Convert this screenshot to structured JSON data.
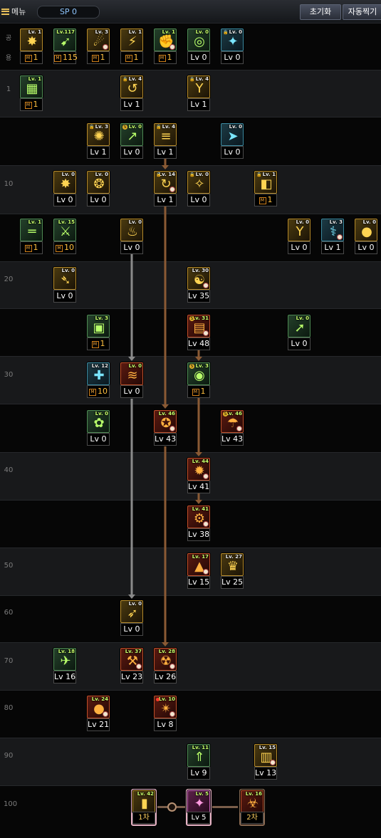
{
  "topbar": {
    "menu_label": "메뉴",
    "sp_label": "SP 0",
    "reset_label": "초기화",
    "auto_label": "자동찍기"
  },
  "common_label": "공 용",
  "row_labels": [
    "1",
    "10",
    "20",
    "30",
    "40",
    "50",
    "60",
    "70",
    "80",
    "90",
    "100"
  ],
  "skills": [
    {
      "id": "c1",
      "tag": "Lv. 1",
      "level": "1",
      "m": true,
      "color": "y",
      "glyph": "✸"
    },
    {
      "id": "c2",
      "tag": "Lv.117",
      "level": "115",
      "m": true,
      "color": "g",
      "glyph": "➹"
    },
    {
      "id": "c3",
      "tag": "Lv. 3",
      "level": "1",
      "m": true,
      "color": "y",
      "glyph": "☄"
    },
    {
      "id": "c4",
      "tag": "Lv. 1",
      "level": "1",
      "m": true,
      "color": "y",
      "glyph": "⚡"
    },
    {
      "id": "c5",
      "tag": "Lv. 1",
      "level": "1",
      "m": true,
      "color": "g",
      "glyph": "✊"
    },
    {
      "id": "c6",
      "tag": "Lv. 0",
      "level": "Lv 0",
      "m": false,
      "color": "g",
      "glyph": "◎"
    },
    {
      "id": "c7",
      "tag": "Lv. 0",
      "level": "Lv 0",
      "m": false,
      "color": "t",
      "glyph": "✦"
    },
    {
      "id": "r1a",
      "tag": "Lv. 1",
      "level": "1",
      "m": true,
      "color": "g",
      "glyph": "▦"
    },
    {
      "id": "r1b",
      "tag": "Lv. 4",
      "level": "Lv 1",
      "m": false,
      "color": "y",
      "glyph": "↺"
    },
    {
      "id": "r1c",
      "tag": "Lv. 4",
      "level": "Lv 1",
      "m": false,
      "color": "y",
      "glyph": "Y"
    },
    {
      "id": "r5a",
      "tag": "Lv. 3",
      "level": "Lv 1",
      "m": false,
      "color": "y",
      "glyph": "✺"
    },
    {
      "id": "r5b",
      "tag": "Lv. 0",
      "level": "Lv 0",
      "m": false,
      "color": "g",
      "glyph": "↗"
    },
    {
      "id": "r5c",
      "tag": "Lv. 4",
      "level": "Lv 1",
      "m": false,
      "color": "y",
      "glyph": "≡"
    },
    {
      "id": "r5d",
      "tag": "Lv. 0",
      "level": "Lv 0",
      "m": false,
      "color": "t",
      "glyph": "➤"
    },
    {
      "id": "r10a",
      "tag": "Lv. 0",
      "level": "Lv 0",
      "m": false,
      "color": "y",
      "glyph": "✸"
    },
    {
      "id": "r10b",
      "tag": "Lv. 0",
      "level": "Lv 0",
      "m": false,
      "color": "y",
      "glyph": "❂"
    },
    {
      "id": "r10c",
      "tag": "Lv. 14",
      "level": "Lv 1",
      "m": false,
      "color": "y",
      "glyph": "↻"
    },
    {
      "id": "r10d",
      "tag": "Lv. 0",
      "level": "Lv 0",
      "m": false,
      "color": "y",
      "glyph": "✧"
    },
    {
      "id": "r10e",
      "tag": "Lv. 1",
      "level": "1",
      "m": true,
      "color": "y",
      "glyph": "◧"
    },
    {
      "id": "r15a",
      "tag": "Lv. 1",
      "level": "1",
      "m": true,
      "color": "g",
      "glyph": "═"
    },
    {
      "id": "r15b",
      "tag": "Lv. 15",
      "level": "10",
      "m": true,
      "color": "g",
      "glyph": "⚔"
    },
    {
      "id": "r15c",
      "tag": "Lv. 0",
      "level": "Lv 0",
      "m": false,
      "color": "y",
      "glyph": "♨"
    },
    {
      "id": "r15d",
      "tag": "Lv. 0",
      "level": "Lv 0",
      "m": false,
      "color": "y",
      "glyph": "Y"
    },
    {
      "id": "r15e",
      "tag": "Lv. 3",
      "level": "Lv 1",
      "m": false,
      "color": "t",
      "glyph": "⚕"
    },
    {
      "id": "r15f",
      "tag": "Lv. 0",
      "level": "Lv 0",
      "m": false,
      "color": "y",
      "glyph": "●"
    },
    {
      "id": "r20a",
      "tag": "Lv. 0",
      "level": "Lv 0",
      "m": false,
      "color": "y",
      "glyph": "➴"
    },
    {
      "id": "r20b",
      "tag": "Lv. 30",
      "level": "Lv 35",
      "m": false,
      "color": "y",
      "glyph": "☯"
    },
    {
      "id": "r25a",
      "tag": "Lv. 3",
      "level": "1",
      "m": true,
      "color": "g",
      "glyph": "▣"
    },
    {
      "id": "r25b",
      "tag": "Lv. 31",
      "level": "Lv 48",
      "m": false,
      "color": "r",
      "glyph": "▤"
    },
    {
      "id": "r25c",
      "tag": "Lv. 0",
      "level": "Lv 0",
      "m": false,
      "color": "g",
      "glyph": "➚"
    },
    {
      "id": "r30a",
      "tag": "Lv. 12",
      "level": "10",
      "m": true,
      "color": "t",
      "glyph": "✚"
    },
    {
      "id": "r30b",
      "tag": "Lv. 0",
      "level": "Lv 0",
      "m": false,
      "color": "r",
      "glyph": "≋"
    },
    {
      "id": "r30c",
      "tag": "Lv. 3",
      "level": "1",
      "m": true,
      "color": "g",
      "glyph": "◉"
    },
    {
      "id": "r35a",
      "tag": "Lv. 0",
      "level": "Lv 0",
      "m": false,
      "color": "g",
      "glyph": "✿"
    },
    {
      "id": "r35b",
      "tag": "Lv. 46",
      "level": "Lv 43",
      "m": false,
      "color": "r",
      "glyph": "✪"
    },
    {
      "id": "r35c",
      "tag": "Lv. 46",
      "level": "Lv 43",
      "m": false,
      "color": "r",
      "glyph": "☂"
    },
    {
      "id": "r40a",
      "tag": "Lv. 44",
      "level": "Lv 41",
      "m": false,
      "color": "r",
      "glyph": "✹"
    },
    {
      "id": "r45a",
      "tag": "Lv. 41",
      "level": "Lv 38",
      "m": false,
      "color": "r",
      "glyph": "⚙"
    },
    {
      "id": "r50a",
      "tag": "Lv. 17",
      "level": "Lv 15",
      "m": false,
      "color": "r",
      "glyph": "▲"
    },
    {
      "id": "r50b",
      "tag": "Lv. 27",
      "level": "Lv 25",
      "m": false,
      "color": "y",
      "glyph": "♛"
    },
    {
      "id": "r60a",
      "tag": "Lv. 0",
      "level": "Lv 0",
      "m": false,
      "color": "y",
      "glyph": "➶"
    },
    {
      "id": "r70a",
      "tag": "Lv. 18",
      "level": "Lv 16",
      "m": false,
      "color": "g",
      "glyph": "✈"
    },
    {
      "id": "r70b",
      "tag": "Lv. 37",
      "level": "Lv 23",
      "m": false,
      "color": "r",
      "glyph": "⚒"
    },
    {
      "id": "r70c",
      "tag": "Lv. 28",
      "level": "Lv 26",
      "m": false,
      "color": "r",
      "glyph": "☢"
    },
    {
      "id": "r80a",
      "tag": "Lv. 24",
      "level": "Lv 21",
      "m": false,
      "color": "r",
      "glyph": "●"
    },
    {
      "id": "r80b",
      "tag": "Lv. 10",
      "level": "Lv 8",
      "m": false,
      "color": "r",
      "glyph": "✴"
    },
    {
      "id": "r90a",
      "tag": "Lv. 11",
      "level": "Lv 9",
      "m": false,
      "color": "g",
      "glyph": "⇑"
    },
    {
      "id": "r90b",
      "tag": "Lv. 15",
      "level": "Lv 13",
      "m": false,
      "color": "y",
      "glyph": "▥"
    }
  ],
  "tiers": [
    {
      "tag": "Lv. 42",
      "label": "1차",
      "color": "y",
      "glyph": "▮"
    },
    {
      "tag": "Lv. 5",
      "label": "Lv 5",
      "color": "p",
      "glyph": "✦"
    },
    {
      "tag": "Lv. 16",
      "label": "2차",
      "color": "r",
      "glyph": "☣"
    }
  ],
  "colors": {
    "arrow_gray": "#8a8a8a",
    "arrow_brown": "#8a5a34",
    "accent": "#e8c05a"
  }
}
